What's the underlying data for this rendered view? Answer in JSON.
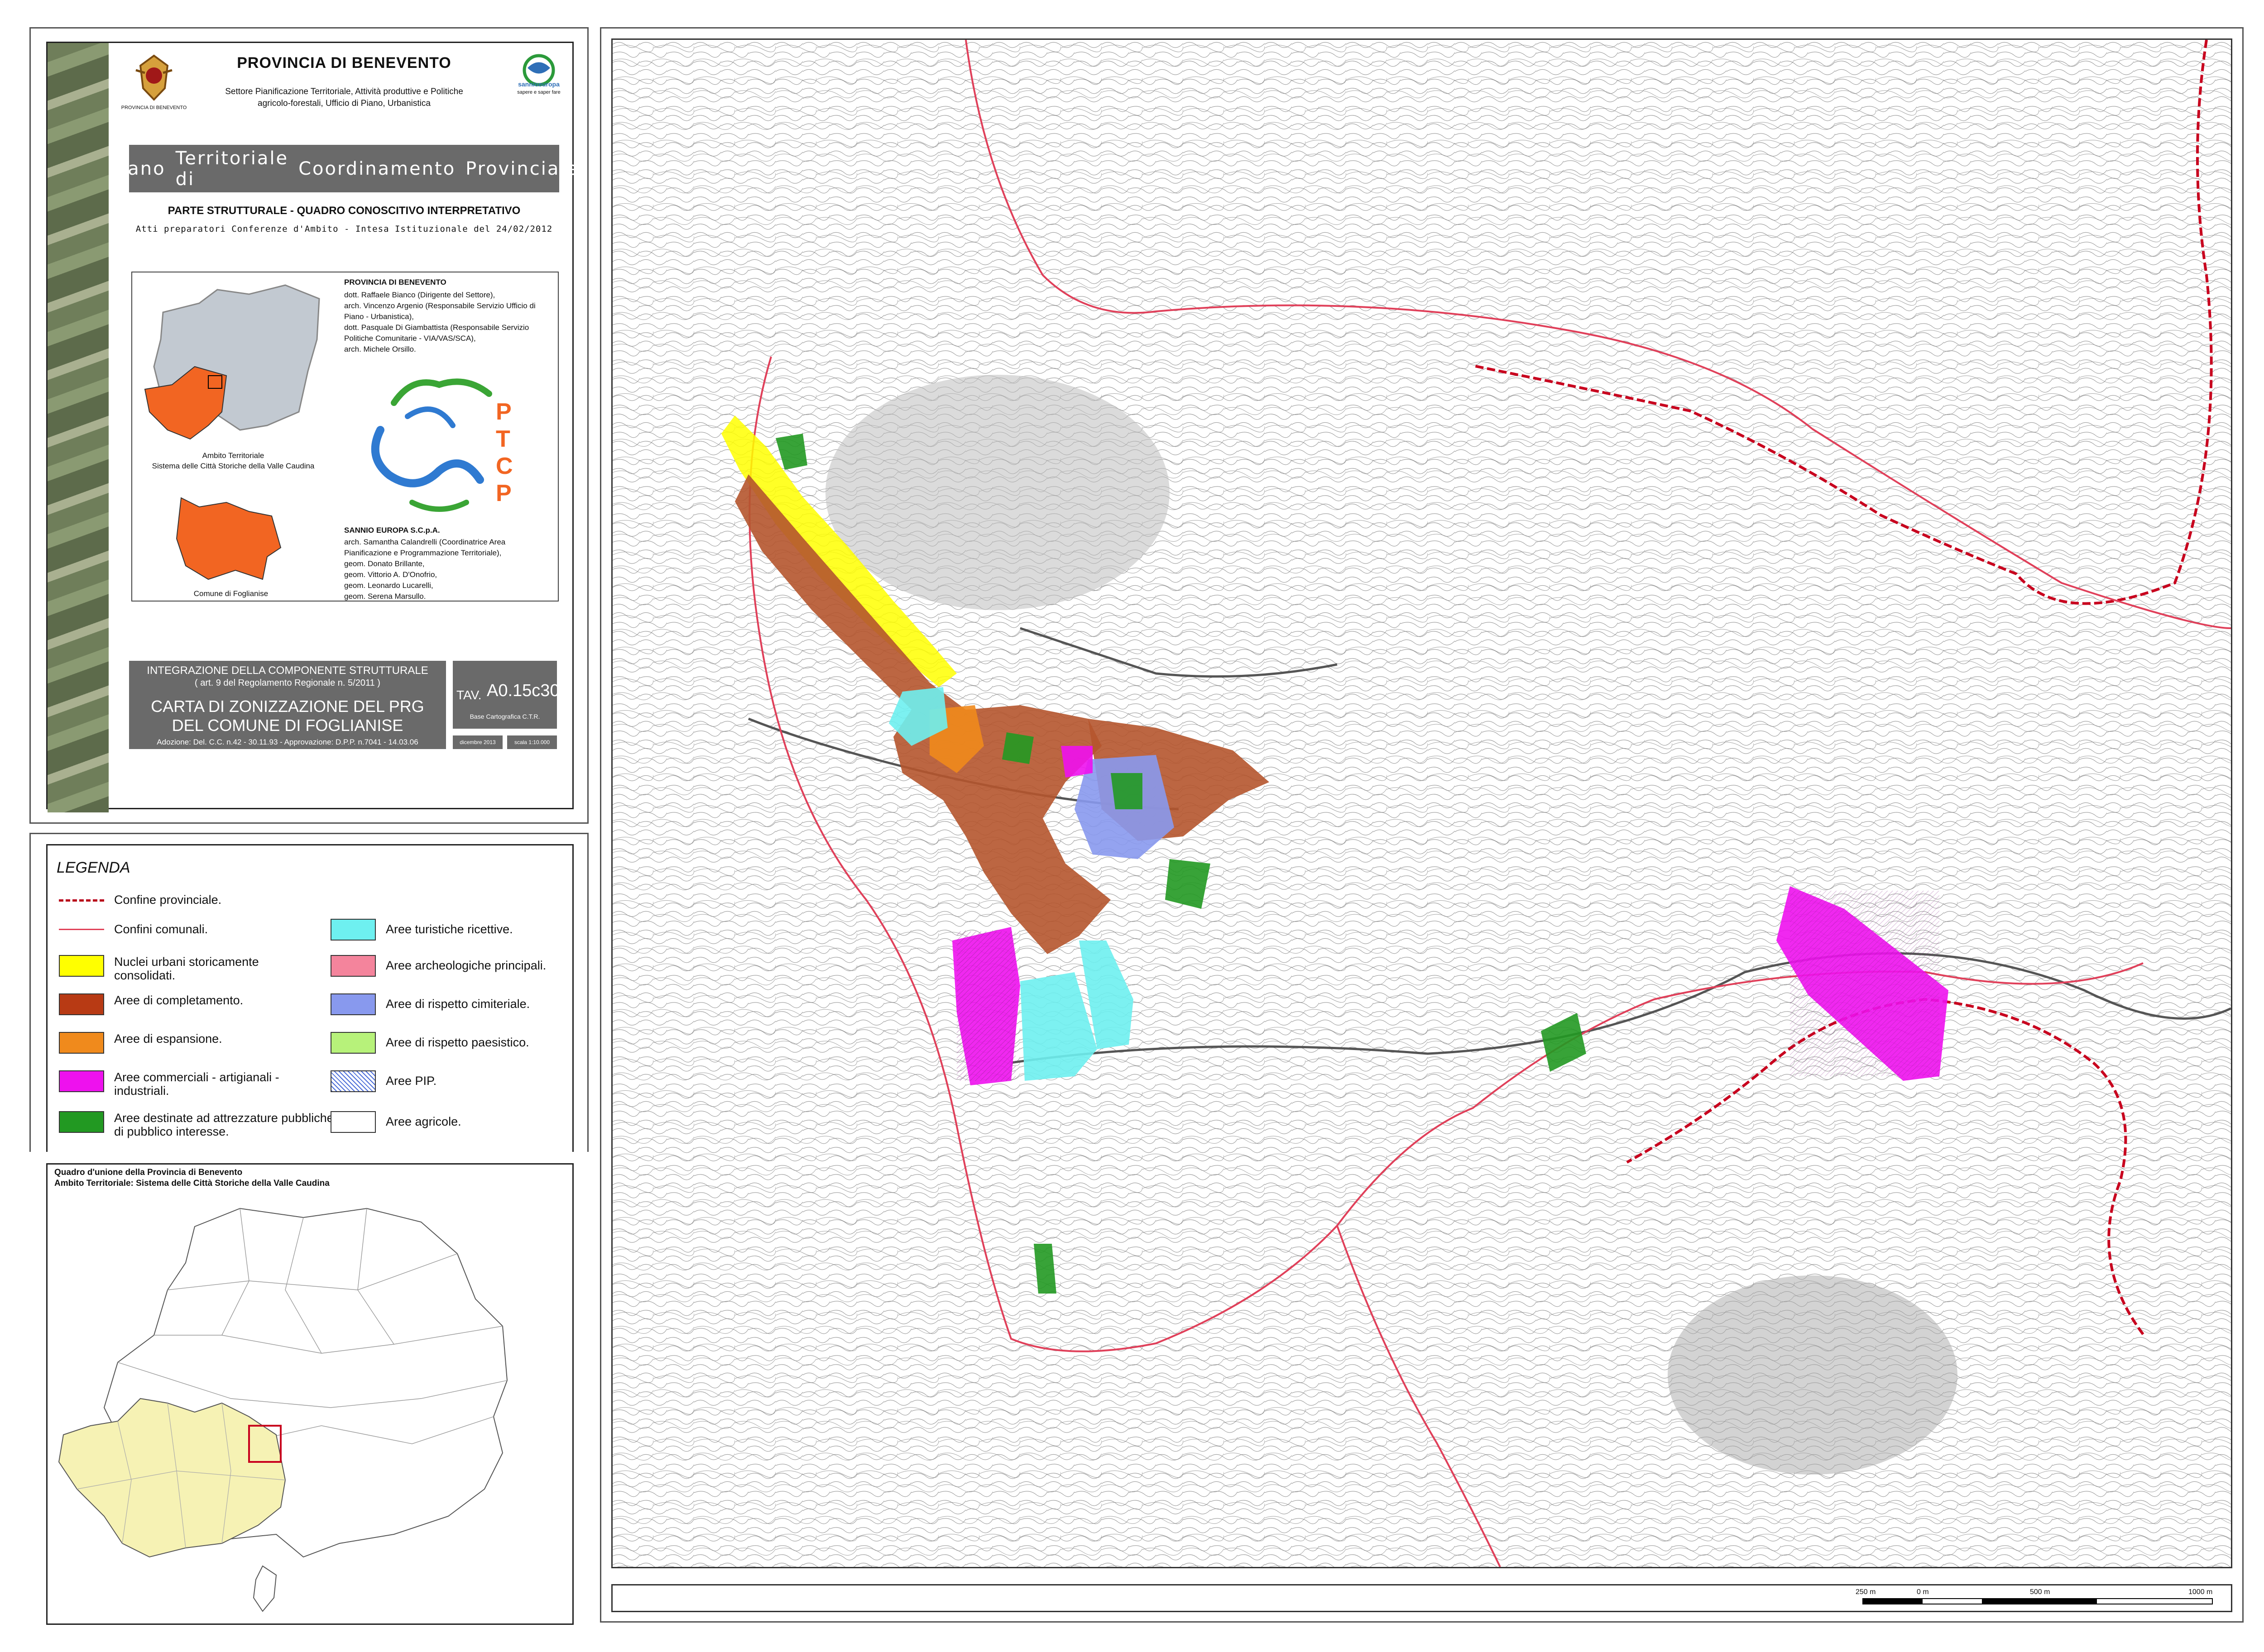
{
  "header": {
    "org_title": "PROVINCIA DI BENEVENTO",
    "org_subtitle_1": "Settore Pianificazione Territoriale, Attività produttive e Politiche",
    "org_subtitle_2": "agricolo-forestali, Ufficio di Piano, Urbanistica",
    "logo_caption": "PROVINCIA DI BENEVENTO",
    "partner_logo_text_1": "sannioeuropa",
    "partner_logo_text_2": "sapere e saper fare"
  },
  "plan": {
    "title_words": [
      "Piano",
      "Territoriale di",
      "Coordinamento",
      "Provinciale"
    ],
    "part_title": "PARTE STRUTTURALE - QUADRO CONOSCITIVO INTERPRETATIVO",
    "part_subtitle": "Atti preparatori Conferenze d'Ambito - Intesa Istituzionale del 24/02/2012"
  },
  "credits": {
    "provincia_heading": "PROVINCIA DI BENEVENTO",
    "provincia_people": [
      "dott. Raffaele Bianco (Dirigente del Settore),",
      "arch. Vincenzo Argenio (Responsabile Servizio Ufficio di",
      "Piano - Urbanistica),",
      "dott. Pasquale Di Giambattista (Responsabile Servizio",
      "Politiche Comunitarie - VIA/VAS/SCA),",
      "arch. Michele Orsillo."
    ],
    "sannio_heading": "SANNIO EUROPA S.C.p.A.",
    "sannio_people": [
      "arch. Samantha Calandrelli (Coordinatrice Area",
      "Pianificazione e Programmazione Territoriale),",
      "geom. Donato Brillante,",
      "geom. Vittorio A. D'Onofrio,",
      "geom. Leonardo Lucarelli,",
      "geom. Serena Marsullo."
    ],
    "ambito_caption_1": "Ambito Territoriale",
    "ambito_caption_2": "Sistema delle Città Storiche della Valle Caudina",
    "comune_caption": "Comune di Foglianise",
    "ptcp_letters": [
      "P",
      "T",
      "C",
      "P"
    ]
  },
  "sheet": {
    "integration_1": "INTEGRAZIONE DELLA COMPONENTE STRUTTURALE",
    "integration_2": "( art. 9 del Regolamento Regionale n. 5/2011 )",
    "map_title_1": "CARTA DI ZONIZZAZIONE DEL PRG",
    "map_title_2": "DEL COMUNE DI FOGLIANISE",
    "adoption": "Adozione: Del. C.C. n.42 - 30.11.93 - Approvazione: D.P.P. n.7041 - 14.03.06",
    "tav_prefix": "TAV.",
    "tav_code": "A0.15c30",
    "base": "Base Cartografica C.T.R.",
    "date": "dicembre 2013",
    "scale": "scala 1:10.000"
  },
  "legend": {
    "title": "LEGENDA",
    "left_items": [
      {
        "kind": "line-dashed",
        "label": "Confine provinciale."
      },
      {
        "kind": "line-thin",
        "label": "Confini comunali."
      },
      {
        "kind": "fill",
        "color": "#ffff00",
        "label": "Nuclei urbani storicamente consolidati."
      },
      {
        "kind": "fill",
        "color": "#b83a14",
        "label": "Aree di completamento."
      },
      {
        "kind": "fill",
        "color": "#f08a1c",
        "label": "Aree di espansione."
      },
      {
        "kind": "fill",
        "color": "#ee11ee",
        "label": "Aree commerciali - artigianali - industriali."
      },
      {
        "kind": "fill",
        "color": "#229922",
        "label": "Aree destinate ad attrezzature pubbliche e di pubblico interesse."
      }
    ],
    "right_items": [
      {
        "kind": "fill",
        "color": "#6ef0f0",
        "label": "Aree turistiche ricettive."
      },
      {
        "kind": "fill",
        "color": "#f4849c",
        "label": "Aree archeologiche principali."
      },
      {
        "kind": "fill",
        "color": "#8899ee",
        "label": "Aree di rispetto cimiteriale."
      },
      {
        "kind": "fill",
        "color": "#b7f27a",
        "label": "Aree di rispetto paesistico."
      },
      {
        "kind": "hatch",
        "color": "#4a6cd8",
        "label": "Aree PIP."
      },
      {
        "kind": "fill",
        "color": "#ffffff",
        "label": "Aree agricole."
      }
    ]
  },
  "overview": {
    "title_1": "Quadro d'unione della Provincia di Benevento",
    "title_2": "Ambito Territoriale: Sistema delle Città Storiche della Valle Caudina"
  },
  "scalebar": {
    "labels": [
      "250 m",
      "0 m",
      "500 m",
      "1000 m"
    ]
  },
  "colors": {
    "provincial_border": "#c8001e",
    "communal_border": "#e0405a",
    "province_grey": "#c2c9d1",
    "ambito_orange": "#f26522",
    "ambito_yellow": "#f6f2b4"
  }
}
